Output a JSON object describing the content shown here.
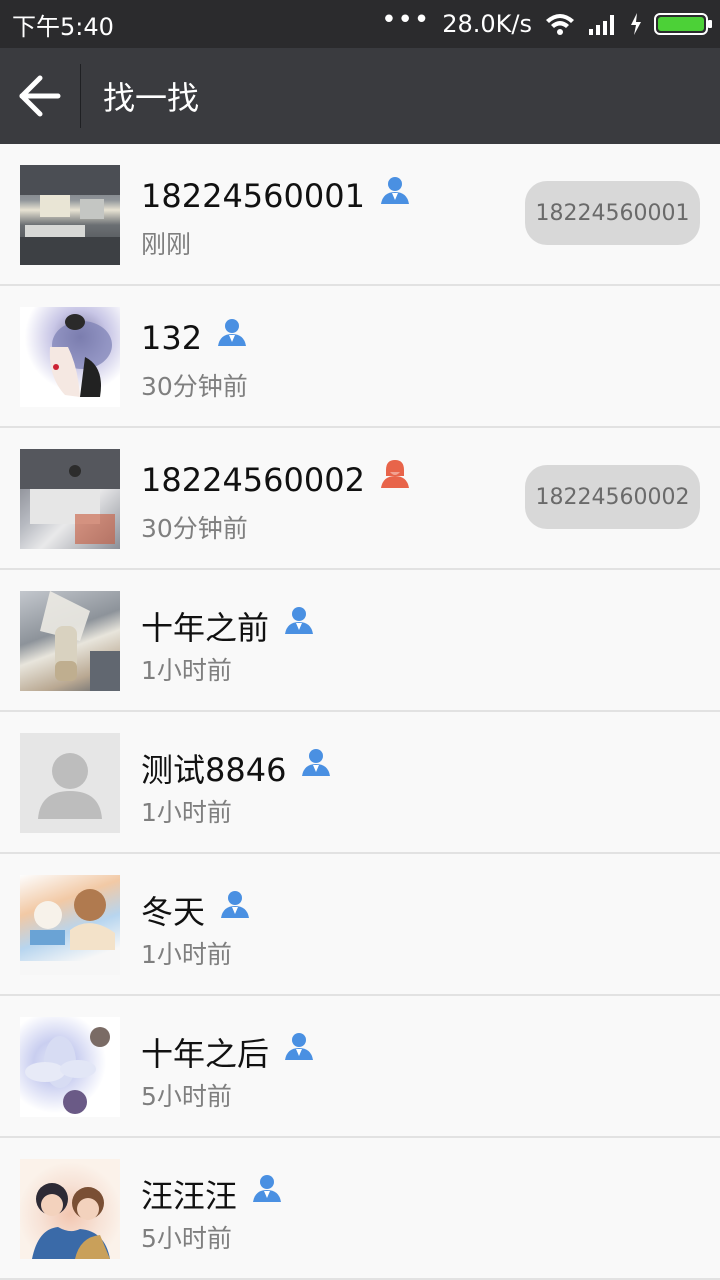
{
  "status": {
    "time": "下午5:40",
    "speed": "28.0K/s",
    "dots": "•••"
  },
  "toolbar": {
    "title": "找一找"
  },
  "contacts": [
    {
      "name": "18224560001",
      "time": "刚刚",
      "gender": "male",
      "phone": "18224560001"
    },
    {
      "name": "132",
      "time": "30分钟前",
      "gender": "male",
      "phone": ""
    },
    {
      "name": "18224560002",
      "time": "30分钟前",
      "gender": "female",
      "phone": "18224560002"
    },
    {
      "name": "十年之前",
      "time": "1小时前",
      "gender": "male",
      "phone": ""
    },
    {
      "name": "测试8846",
      "time": "1小时前",
      "gender": "male",
      "phone": ""
    },
    {
      "name": "冬天",
      "time": "1小时前",
      "gender": "male",
      "phone": ""
    },
    {
      "name": "十年之后",
      "time": "5小时前",
      "gender": "male",
      "phone": ""
    },
    {
      "name": "汪汪汪",
      "time": "5小时前",
      "gender": "male",
      "phone": ""
    }
  ],
  "colors": {
    "male_icon": "#4a90e2",
    "female_icon": "#e8644a",
    "toolbar_bg": "#3a3b3f",
    "status_bg": "#2b2b2d"
  }
}
